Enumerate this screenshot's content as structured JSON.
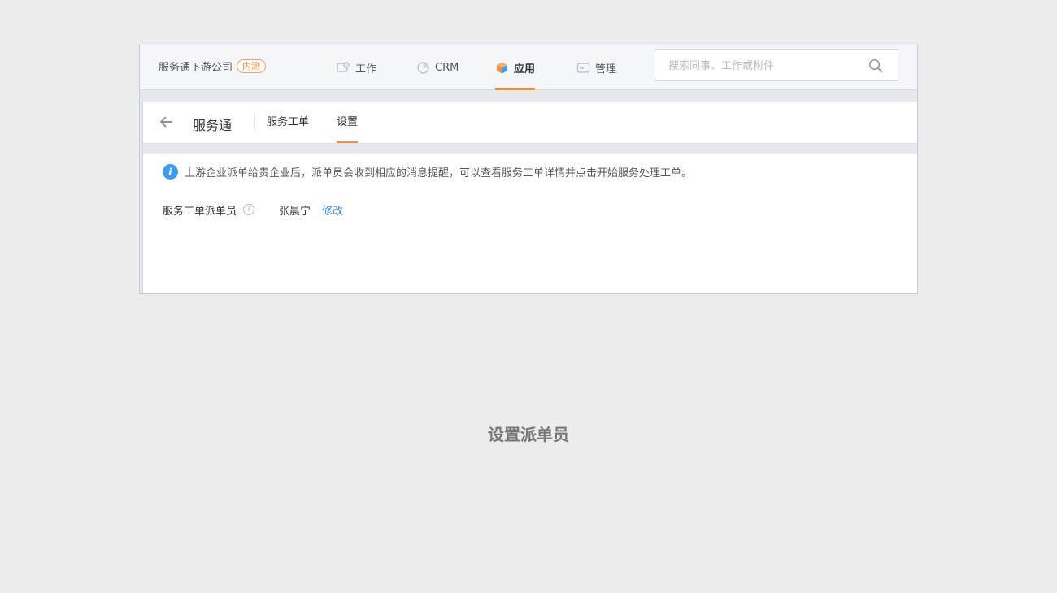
{
  "company": {
    "name": "服务通下游公司",
    "badge": "内测"
  },
  "nav": [
    {
      "label": "工作",
      "icon": "work-icon",
      "active": false
    },
    {
      "label": "CRM",
      "icon": "crm-pie-icon",
      "active": false
    },
    {
      "label": "应用",
      "icon": "app-cube-icon",
      "active": true
    },
    {
      "label": "管理",
      "icon": "manage-icon",
      "active": false
    }
  ],
  "search": {
    "placeholder": "搜索同事、工作或附件",
    "value": ""
  },
  "subnav": {
    "app_name": "服务通",
    "tabs": [
      {
        "label": "服务工单",
        "active": false
      },
      {
        "label": "设置",
        "active": true
      }
    ]
  },
  "notice": "上游企业派单给贵企业后，派单员会收到相应的消息提醒，可以查看服务工单详情并点击开始服务处理工单。",
  "setting": {
    "label": "服务工单派单员",
    "help": "?",
    "assignee": "张晨宁",
    "edit_label": "修改"
  },
  "caption": "设置派单员",
  "colors": {
    "accent": "#f28b3d",
    "link": "#3a7fd6",
    "info": "#3c9cf0"
  }
}
